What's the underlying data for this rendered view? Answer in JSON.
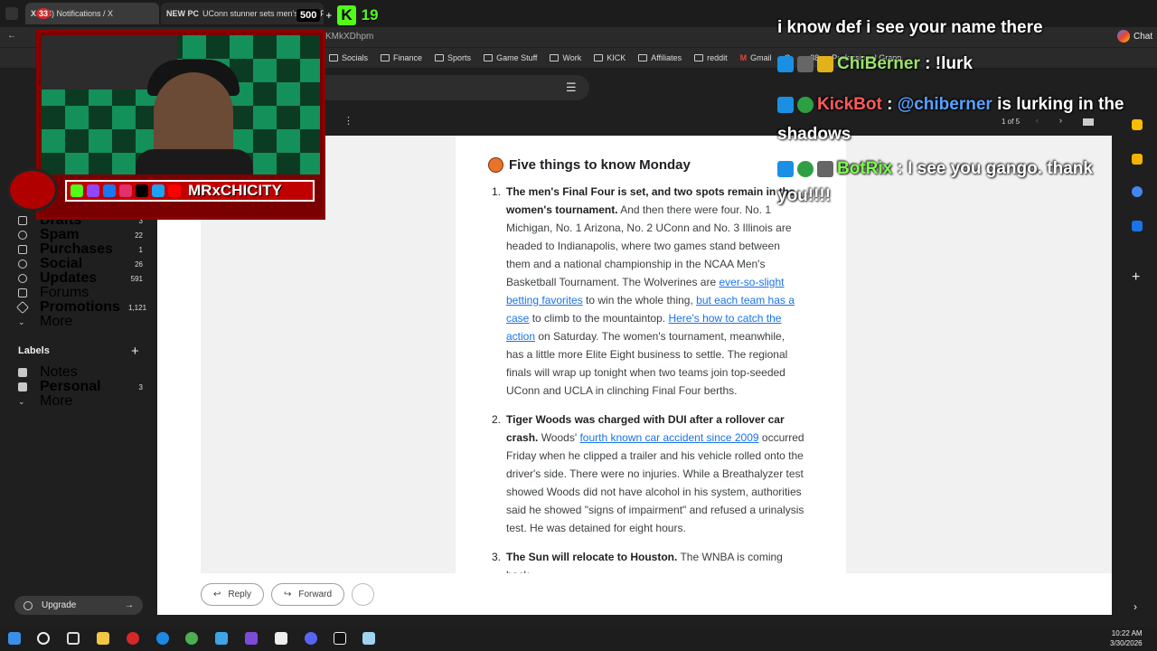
{
  "browser": {
    "tabs": [
      {
        "title": "(33) Notifications / X",
        "count": "33"
      },
      {
        "title": "NEW PC"
      },
      {
        "title": "UConn stunner sets men's Final Four"
      }
    ],
    "tab_badges": [
      "500",
      "K",
      "19"
    ],
    "address_fragment": "KMkXDhpm",
    "bookmarks": [
      "Socials",
      "Finance",
      "Sports",
      "Game Stuff",
      "Work",
      "KICK",
      "Affiliates",
      "reddit",
      "Gmail",
      "G",
      "...38",
      "Professional Grapp..."
    ],
    "chat_button": "Chat"
  },
  "gmail": {
    "nav": [
      {
        "label": "Drafts",
        "count": "3"
      },
      {
        "label": "Spam",
        "count": "22"
      },
      {
        "label": "Purchases",
        "count": "1"
      },
      {
        "label": "Social",
        "count": "26"
      },
      {
        "label": "Updates",
        "count": "591"
      },
      {
        "label": "Forums",
        "count": ""
      },
      {
        "label": "Promotions",
        "count": "1,121"
      },
      {
        "label": "More",
        "count": ""
      }
    ],
    "labels_heading": "Labels",
    "labels": [
      {
        "label": "Notes",
        "count": ""
      },
      {
        "label": "Personal",
        "count": "3"
      },
      {
        "label": "More",
        "count": ""
      }
    ],
    "upgrade": "Upgrade",
    "pager": "1 of 5",
    "reply_label": "Reply",
    "forward_label": "Forward"
  },
  "newsletter": {
    "title": "Five things to know Monday",
    "items": [
      {
        "num": "1.",
        "bold": "The men's Final Four is set, and two spots remain in the women's tournament.",
        "text1": " And then there were four. No. 1 Michigan, No. 1 Arizona, No. 2 UConn and No. 3 Illinois are headed to Indianapolis, where two games stand between them and a national championship in the NCAA Men's Basketball Tournament. The Wolverines are ",
        "link1": "ever-so-slight betting favorites",
        "text2": " to win the whole thing, ",
        "link2": "but each team has a case",
        "text3": " to climb to the mountaintop. ",
        "link3": "Here's how to catch the action",
        "text4": " on Saturday. The women's tournament, meanwhile, has a little more Elite Eight business to settle. The regional finals will wrap up tonight when two teams join top-seeded UConn and UCLA in clinching Final Four berths."
      },
      {
        "num": "2.",
        "bold": "Tiger Woods was charged with DUI after a rollover car crash.",
        "text1": " Woods' ",
        "link1": "fourth known car accident since 2009",
        "text2": " occurred Friday when he clipped a trailer and his vehicle rolled onto the driver's side. There were no injuries. While a Breathalyzer test showed Woods did not have alcohol in his system, authorities said he showed \"signs of impairment\" and refused a urinalysis test. He was detained for eight hours."
      },
      {
        "num": "3.",
        "bold": "The Sun will relocate to Houston.",
        "text1": " The WNBA is coming back"
      }
    ]
  },
  "stream": {
    "channel_name": "MRxCHICITY"
  },
  "chat": [
    {
      "user": "",
      "message": "i know def i see your name there"
    },
    {
      "user": "ChiBerner",
      "user_color": "#9be36b",
      "message": " : !lurk"
    },
    {
      "user": "KickBot",
      "user_color": "#ff5a5a",
      "message": " : ",
      "mention": "@chiberner",
      "mention_color": "#5aa0ff",
      "message2": " is lurking in the shadows"
    },
    {
      "user": "BotRix",
      "user_color": "#7cff4a",
      "message": " : I see you gango. thank you!!!!"
    }
  ],
  "clock": {
    "time": "10:22 AM",
    "date": "3/30/2026"
  }
}
